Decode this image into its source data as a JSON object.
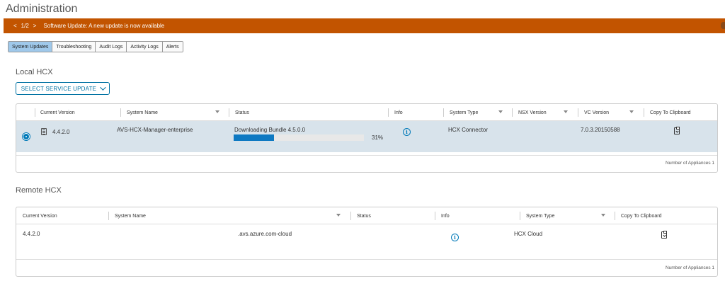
{
  "page": {
    "title": "Administration"
  },
  "banner": {
    "prev": "<",
    "page_indicator": "1/2",
    "next": ">",
    "message": "Software Update: A new update is now available"
  },
  "tabs": [
    {
      "label": "System Updates",
      "active": true
    },
    {
      "label": "Troubleshooting",
      "active": false
    },
    {
      "label": "Audit Logs",
      "active": false
    },
    {
      "label": "Activity Logs",
      "active": false
    },
    {
      "label": "Alerts",
      "active": false
    }
  ],
  "local": {
    "title": "Local HCX",
    "select_button": "SELECT SERVICE UPDATE",
    "columns": {
      "current_version": "Current Version",
      "system_name": "System Name",
      "status": "Status",
      "info": "Info",
      "system_type": "System Type",
      "nsx_version": "NSX Version",
      "vc_version": "VC Version",
      "copy": "Copy To Clipboard"
    },
    "row": {
      "current_version": "4.4.2.0",
      "system_name": "AVS-HCX-Manager-enterprise",
      "status": "Downloading Bundle 4.5.0.0",
      "progress_percent": 31,
      "progress_label": "31%",
      "system_type": "HCX Connector",
      "nsx_version": "",
      "vc_version": "7.0.3.20150588"
    },
    "footer": "Number of Appliances 1"
  },
  "remote": {
    "title": "Remote HCX",
    "columns": {
      "current_version": "Current Version",
      "system_name": "System Name",
      "status": "Status",
      "info": "Info",
      "system_type": "System Type",
      "copy": "Copy To Clipboard"
    },
    "row": {
      "current_version": "4.4.2.0",
      "system_name": ".avs.azure.com-cloud",
      "status": "",
      "system_type": "HCX Cloud"
    },
    "footer": "Number of Appliances 1"
  },
  "colors": {
    "banner": "#c25400",
    "accent": "#0079b8",
    "selected_row": "#d8e3eb",
    "active_tab": "#9fc8ea"
  }
}
